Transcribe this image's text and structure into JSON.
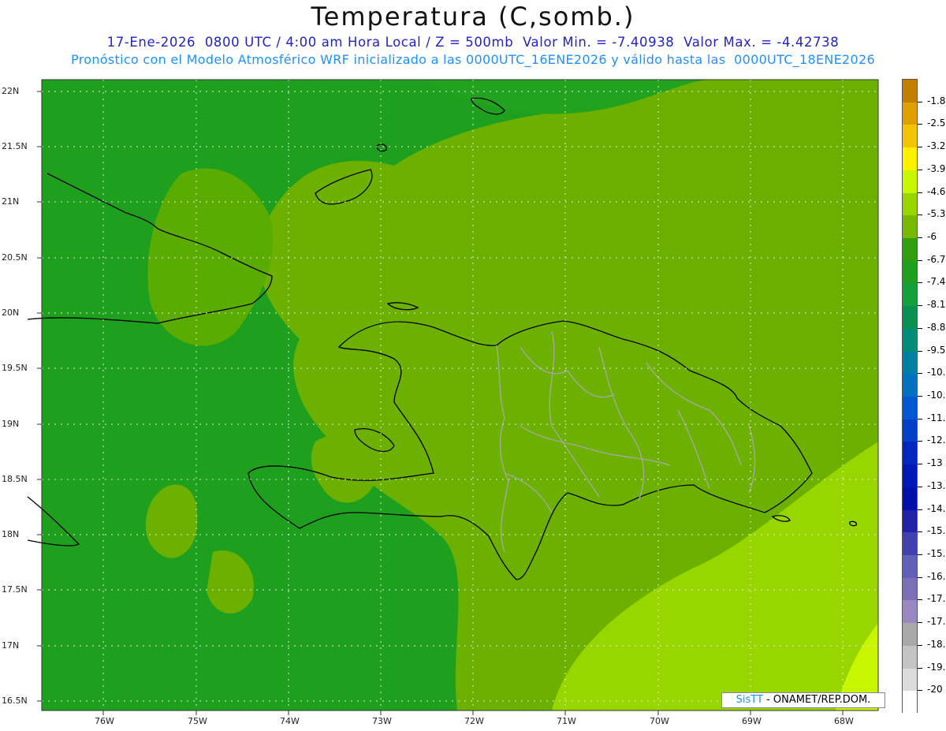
{
  "title": "Temperatura (C,somb.)",
  "subtitle_line1": "17-Ene-2026  0800 UTC / 4:00 am Hora Local / Z = 500mb  Valor Min. = -7.40938  Valor Max. = -4.42738",
  "subtitle_line2": "Pronóstico con el Modelo Atmosférico WRF inicializado a las 0000UTC_16ENE2026 y válido hasta las  0000UTC_18ENE2026",
  "lat_labels": [
    "22N",
    "21.5N",
    "21N",
    "20.5N",
    "20N",
    "19.5N",
    "19N",
    "18.5N",
    "18N",
    "17.5N",
    "17N",
    "16.5N"
  ],
  "lon_labels": [
    "76W",
    "75W",
    "74W",
    "73W",
    "72W",
    "71W",
    "70W",
    "69W",
    "68W"
  ],
  "legend": {
    "labels": [
      "-1.8",
      "-2.5",
      "-3.2",
      "-3.9",
      "-4.6",
      "-5.3",
      "-6",
      "-6.7",
      "-7.4",
      "-8.1",
      "-8.8",
      "-9.5",
      "-10.2",
      "-10.9",
      "-11.6",
      "-12.3",
      "-13",
      "-13.7",
      "-14.4",
      "-15.1",
      "-15.8",
      "-16.5",
      "-17.2",
      "-17.9",
      "-18.6",
      "-19.3",
      "-20"
    ],
    "colors": [
      "#c47f00",
      "#e0a000",
      "#f5c400",
      "#fff000",
      "#c8f500",
      "#98d600",
      "#78b800",
      "#30a010",
      "#1ea01e",
      "#14a03c",
      "#0a9050",
      "#008c78",
      "#0080a0",
      "#0070c0",
      "#0058d0",
      "#0040c8",
      "#0028c0",
      "#0018b8",
      "#0010a8",
      "#2020a8",
      "#4040b0",
      "#6060b8",
      "#7a70b8",
      "#9a88c0",
      "#a8a8a8",
      "#c4c4c4",
      "#dcdcdc",
      "#ffffff"
    ]
  },
  "credit": {
    "brand": "SisTT",
    "text": " - ONAMET/REP.DOM."
  },
  "colors": {
    "deep_green": "#1ea01e",
    "mid_green": "#5cb000",
    "olive": "#78b800",
    "light_green": "#98d600",
    "lime": "#c8f500"
  }
}
